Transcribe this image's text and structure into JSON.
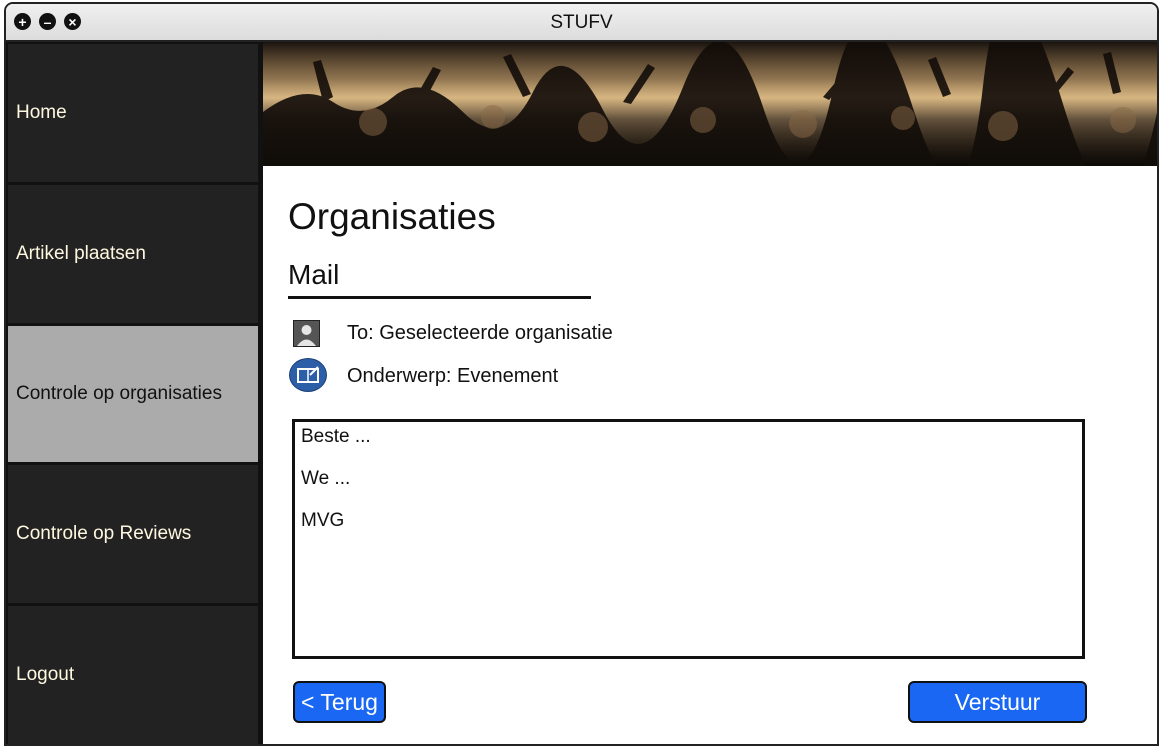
{
  "window": {
    "title": "STUFV",
    "controls": [
      {
        "icon": "plus-circle-icon",
        "glyph": "+"
      },
      {
        "icon": "minus-circle-icon",
        "glyph": "–"
      },
      {
        "icon": "close-circle-icon",
        "glyph": "×"
      }
    ]
  },
  "sidebar": {
    "items": [
      {
        "label": "Home",
        "active": false
      },
      {
        "label": "Artikel plaatsen",
        "active": false
      },
      {
        "label": "Controle op organisaties",
        "active": true
      },
      {
        "label": "Controle op Reviews",
        "active": false
      },
      {
        "label": "Logout",
        "active": false
      }
    ]
  },
  "banner": {
    "icon": "concert-crowd-image"
  },
  "main": {
    "title": "Organisaties",
    "subtitle": "Mail",
    "to_label": "To: Geselecteerde organisatie",
    "subject_label": "Onderwerp: Evenement",
    "message_lines": [
      "Beste ...",
      "We ...",
      "MVG"
    ],
    "back_button": "< Terug",
    "send_button": "Verstuur"
  },
  "colors": {
    "accent": "#1967f2",
    "sidebar_bg": "#222222",
    "sidebar_active": "#ababab",
    "sidebar_text": "#fff8e0"
  }
}
